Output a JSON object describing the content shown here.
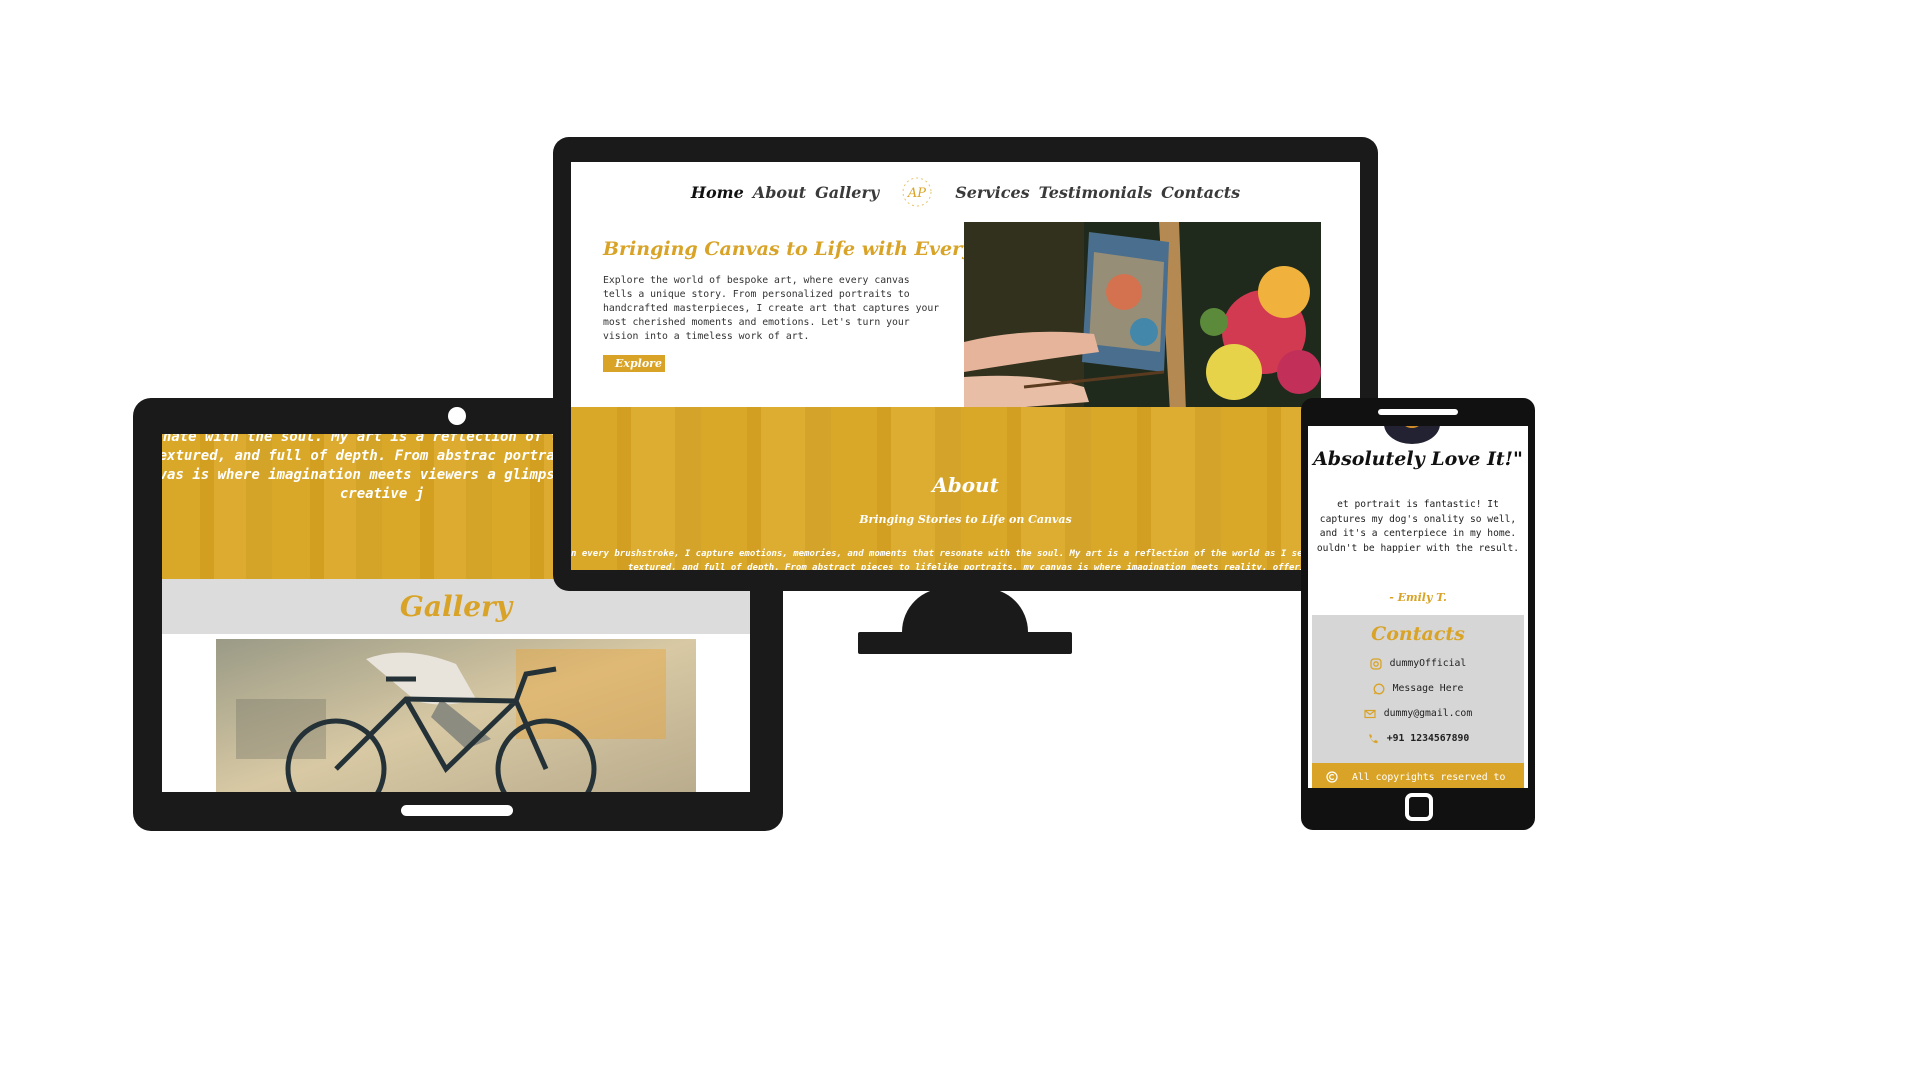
{
  "colors": {
    "accent": "#d8a326",
    "device": "#1a1a1a",
    "gray_panel": "#dcdcdc"
  },
  "monitor": {
    "nav": {
      "items_left": [
        "Home",
        "About",
        "Gallery"
      ],
      "items_right": [
        "Services",
        "Testimonials",
        "Contacts"
      ],
      "logo_text": "AP"
    },
    "hero": {
      "title": "Bringing Canvas to Life with Every Stroke",
      "text": "Explore the world of bespoke art, where every canvas tells a unique story. From personalized portraits to handcrafted masterpieces, I create art that captures your most cherished moments and emotions. Let's turn your vision into a timeless work of art.",
      "button": "Explore"
    },
    "about": {
      "title": "About",
      "subtitle": "Bringing Stories to Life on Canvas",
      "text": "n every brushstroke, I capture emotions, memories, and moments that resonate with the soul. My art is a reflection of the world as I see it vibrant, textured, and full of depth. From abstract pieces to lifelike portraits, my canvas is where imagination meets reality, offering"
    }
  },
  "tablet": {
    "about_text": "resonate with the soul. My art is a reflection of t vibrant, textured, and full of depth. From abstrac portraits, my canvas is where imagination meets viewers a glimpse into my creative j",
    "gallery_title": "Gallery"
  },
  "phone": {
    "quote": "Absolutely Love It!\"",
    "text": "et portrait is fantastic! It captures my dog's onality so well, and it's a centerpiece in my home. ouldn't be happier with the result.",
    "author": "- Emily T.",
    "contacts_title": "Contacts",
    "contacts": [
      {
        "icon": "instagram-icon",
        "label": "dummyOfficial"
      },
      {
        "icon": "whatsapp-icon",
        "label": "Message Here"
      },
      {
        "icon": "mail-icon",
        "label": "dummy@gmail.com"
      },
      {
        "icon": "phone-icon",
        "label": "+91 1234567890"
      }
    ],
    "footer": "All copyrights reserved to"
  }
}
